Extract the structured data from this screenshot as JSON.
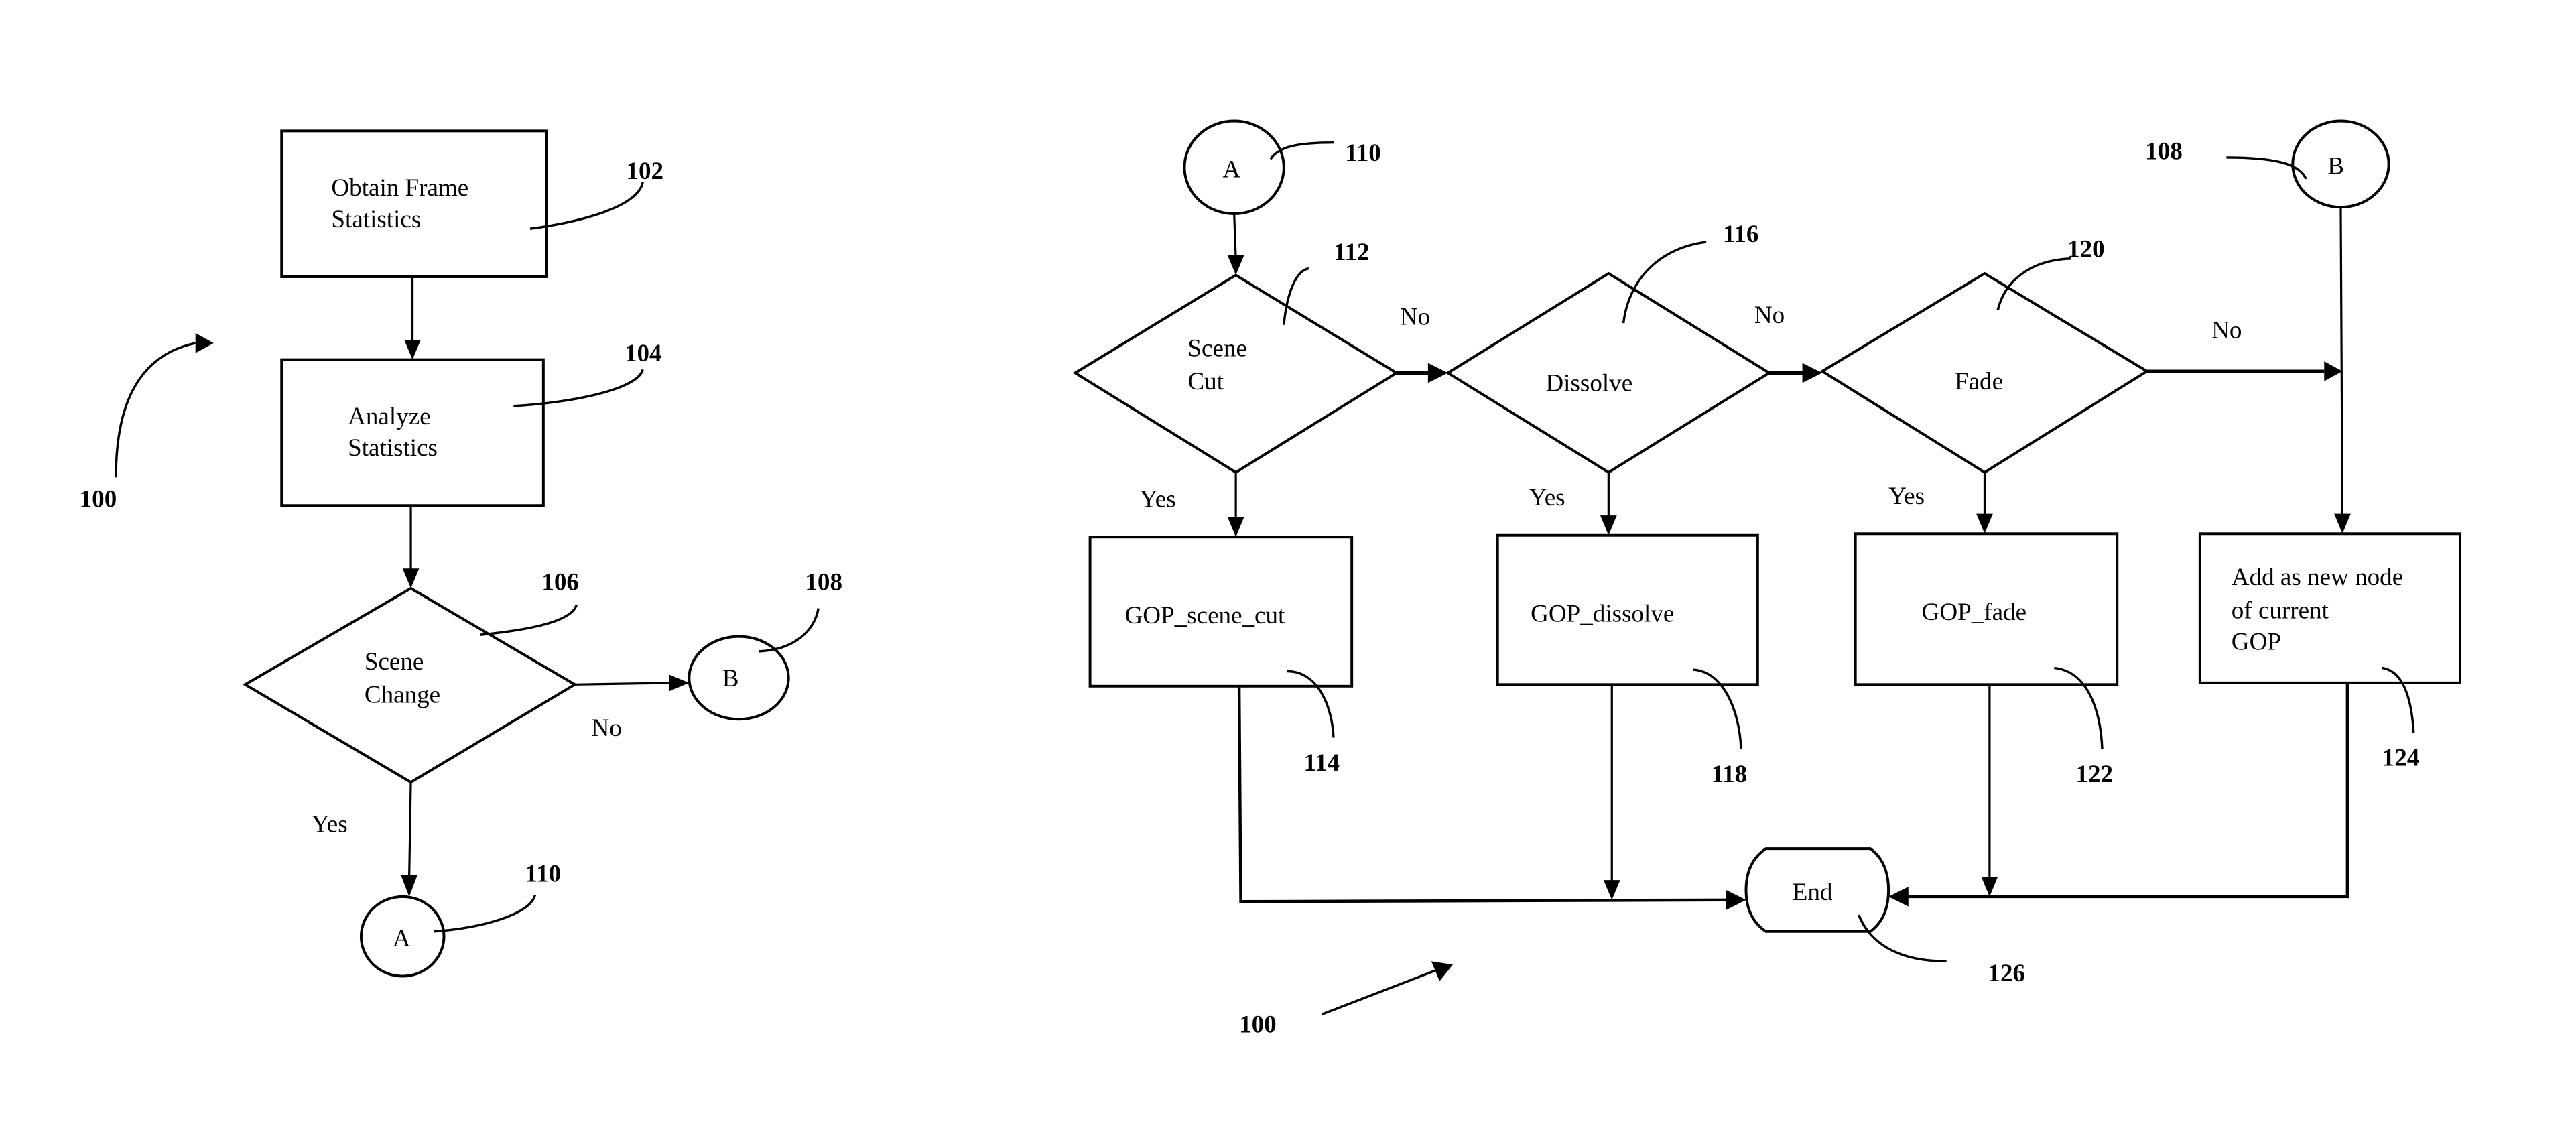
{
  "figure": {
    "reference_numeral": "100",
    "left_flow": {
      "nodes": [
        {
          "id": "102",
          "type": "process",
          "lines": [
            "Obtain Frame",
            "Statistics"
          ]
        },
        {
          "id": "104",
          "type": "process",
          "lines": [
            "Analyze",
            "Statistics"
          ]
        },
        {
          "id": "106",
          "type": "decision",
          "lines": [
            "Scene",
            "Change"
          ]
        },
        {
          "id": "108",
          "type": "connector",
          "lines": [
            "B"
          ]
        },
        {
          "id": "110",
          "type": "connector",
          "lines": [
            "A"
          ]
        }
      ],
      "edge_labels": {
        "no": "No",
        "yes": "Yes"
      }
    },
    "right_flow": {
      "connectors": [
        {
          "id": "110",
          "label": "A"
        },
        {
          "id": "108",
          "label": "B"
        }
      ],
      "decisions": [
        {
          "id": "112",
          "lines": [
            "Scene",
            "Cut"
          ]
        },
        {
          "id": "116",
          "lines": [
            "Dissolve"
          ]
        },
        {
          "id": "120",
          "lines": [
            "Fade"
          ]
        }
      ],
      "processes": [
        {
          "id": "114",
          "lines": [
            "GOP_scene_cut"
          ]
        },
        {
          "id": "118",
          "lines": [
            "GOP_dissolve"
          ]
        },
        {
          "id": "122",
          "lines": [
            "GOP_fade"
          ]
        },
        {
          "id": "124",
          "lines": [
            "Add as new node",
            "of current",
            "GOP"
          ]
        }
      ],
      "terminal": {
        "id": "126",
        "label": "End"
      },
      "edge_labels": {
        "no": "No",
        "yes": "Yes"
      }
    }
  }
}
